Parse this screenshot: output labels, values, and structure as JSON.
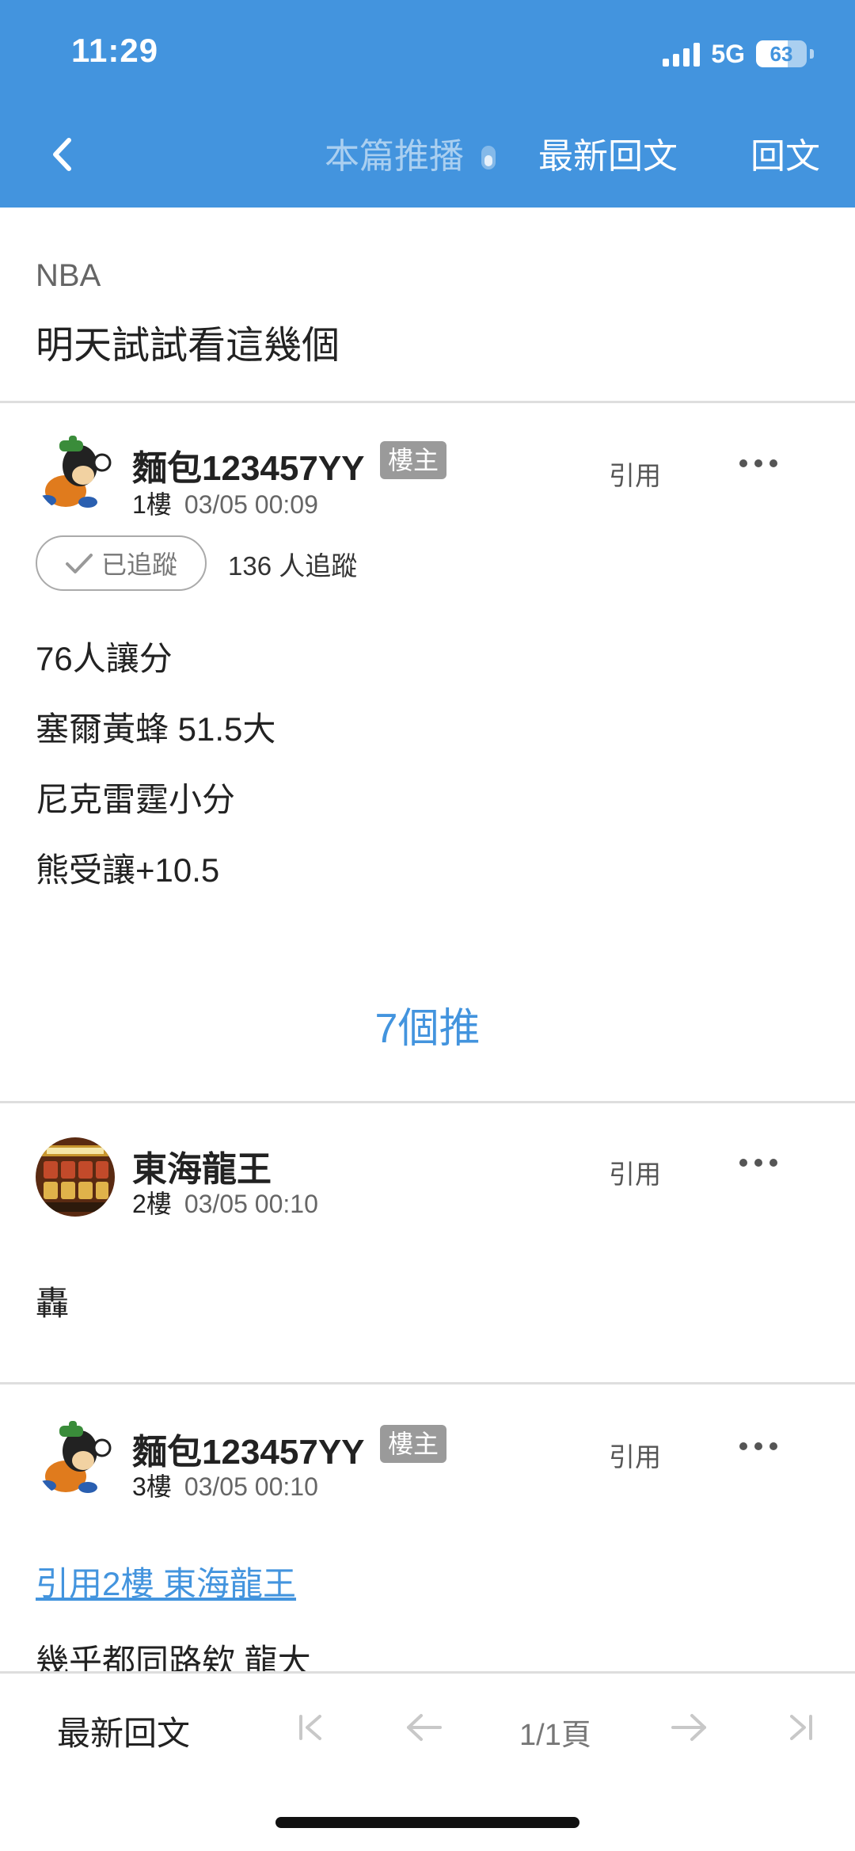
{
  "status_bar": {
    "time": "11:29",
    "network": "5G",
    "battery": "63",
    "battery_level": 0.63
  },
  "nav": {
    "back_label": "back",
    "broadcast": "本篇推播",
    "latest_replies": "最新回文",
    "reply": "回文"
  },
  "thread": {
    "board": "NBA",
    "title": "明天試試看這幾個"
  },
  "posts": [
    {
      "username": "麵包123457YY",
      "badge": "樓主",
      "floor": "1樓",
      "datetime": "03/05 00:09",
      "quote_label": "引用",
      "follow_label": "已追蹤",
      "follow_count": "136 人追蹤",
      "lines": [
        "76人讓分",
        "塞爾黃蜂 51.5大",
        "尼克雷霆小分",
        "熊受讓+10.5"
      ],
      "push_count": "7個推"
    },
    {
      "username": "東海龍王",
      "floor": "2樓",
      "datetime": "03/05 00:10",
      "quote_label": "引用",
      "lines": [
        "轟"
      ]
    },
    {
      "username": "麵包123457YY",
      "badge": "樓主",
      "floor": "3樓",
      "datetime": "03/05 00:10",
      "quote_label": "引用",
      "quote_link": "引用2樓 東海龍王",
      "lines": [
        "幾乎都同路欸 龍大"
      ]
    }
  ],
  "bottom_bar": {
    "latest_replies": "最新回文",
    "page": "1/1頁"
  },
  "colors": {
    "accent": "#4394de",
    "badge": "#9a9a9a",
    "divider": "#dedede"
  }
}
